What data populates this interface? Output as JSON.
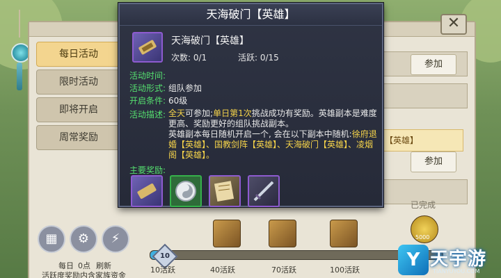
{
  "tooltip": {
    "title": "天海破门【英雄】",
    "item_name": "天海破门【英雄】",
    "count_label": "次数: 0/1",
    "activity_label": "活跃: 0/15",
    "rows": [
      {
        "label": "活动时间:",
        "value": ""
      },
      {
        "label": "活动形式:",
        "value": "组队参加"
      },
      {
        "label": "开启条件:",
        "value": "60级"
      },
      {
        "label": "活动描述:",
        "value": ""
      }
    ],
    "description": {
      "p1_yellow1": "全天",
      "p1_text1": "可参加;",
      "p1_yellow2": "单日第1次",
      "p1_text2": "挑战成功有奖励。英雄副本是难度更高、奖励更好的组队挑战副本。",
      "p2_text": "英雄副本每日随机开启一个, 会在以下副本中随机:",
      "p2_yellow": "徐府退婚【英雄】、国教剑阵【英雄】、天海破门【英雄】、凌烟阁【英雄】。"
    },
    "rewards_label": "主要奖励:",
    "rewards": [
      "scroll-icon",
      "spirit-orb-icon",
      "scroll-bundle-icon",
      "sword-icon"
    ]
  },
  "sidebar": {
    "tabs": [
      "每日活动",
      "限时活动",
      "即将开启",
      "周常奖励"
    ],
    "active_index": 0
  },
  "background": {
    "participate_label": "参加",
    "hero_tag": "【英雄】",
    "completed_label": "已完成",
    "close_label": "✕"
  },
  "bottom": {
    "daily_label": "每日",
    "zero_label": "0点",
    "refresh_label": "刷新",
    "footnote": "活跃度奖励内含家族资金",
    "progress_value": "10",
    "progress_fraction": 0.05,
    "milestones": [
      "10活跃",
      "40活跃",
      "70活跃",
      "100活跃"
    ],
    "chest_badge": "5000"
  },
  "watermark": {
    "name": "天宇游",
    "url": "TIANYUYOU.COM"
  }
}
